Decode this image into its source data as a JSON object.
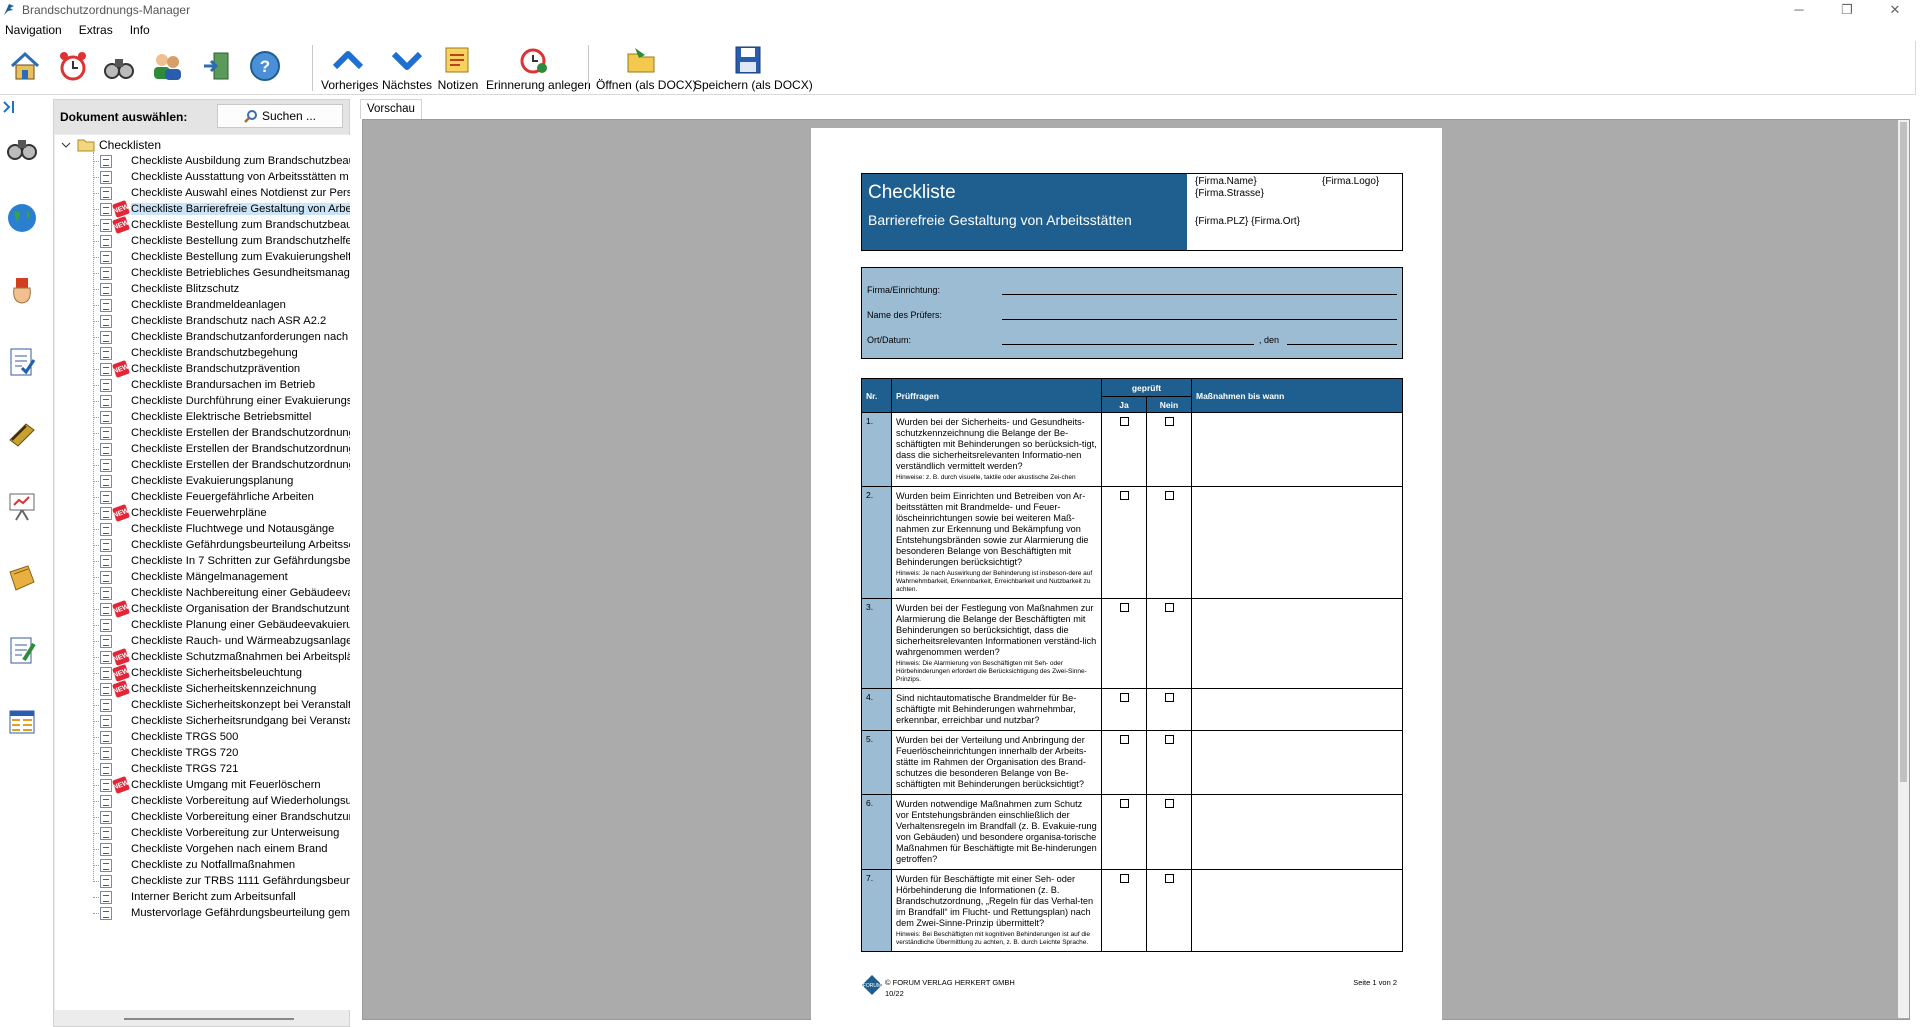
{
  "window": {
    "title": "Brandschutzordnungs-Manager",
    "controls": [
      "─",
      "❐",
      "✕"
    ]
  },
  "menu": [
    "Navigation",
    "Extras",
    "Info"
  ],
  "toolbar": {
    "left_icons": [
      "home-icon",
      "alarm-clock-icon",
      "binoculars-icon",
      "users-icon",
      "exit-icon",
      "help-icon"
    ],
    "buttons": [
      {
        "name": "previous-button",
        "label": "Vorheriges",
        "icon": "chevron-up-icon"
      },
      {
        "name": "next-button",
        "label": "Nächstes",
        "icon": "chevron-down-icon"
      },
      {
        "name": "notes-button",
        "label": "Notizen",
        "icon": "notes-icon"
      },
      {
        "name": "reminder-button",
        "label": "Erinnerung anlegen",
        "icon": "alarm-add-icon"
      },
      {
        "name": "open-docx-button",
        "label": "Öffnen (als DOCX)",
        "icon": "folder-open-icon"
      },
      {
        "name": "save-docx-button",
        "label": "Speichern (als DOCX)",
        "icon": "floppy-icon"
      }
    ]
  },
  "docpanel": {
    "header": "Dokument auswählen:",
    "search_label": "Suchen ...",
    "root": "Checklisten"
  },
  "tree_items": [
    {
      "label": "Checkliste Ausbildung zum Brandschutzbeauf",
      "new": false
    },
    {
      "label": "Checkliste Ausstattung von Arbeitsstätten m",
      "new": false
    },
    {
      "label": "Checkliste Auswahl eines Notdienst zur Pers",
      "new": false
    },
    {
      "label": "Checkliste Barrierefreie Gestaltung von Arbei",
      "new": true,
      "selected": true
    },
    {
      "label": "Checkliste Bestellung zum Brandschutzbeauf",
      "new": true
    },
    {
      "label": "Checkliste Bestellung zum Brandschutzhelfer",
      "new": false
    },
    {
      "label": "Checkliste Bestellung zum Evakuierungshelfe",
      "new": false
    },
    {
      "label": "Checkliste Betriebliches Gesundheitsmanager",
      "new": false
    },
    {
      "label": "Checkliste Blitzschutz",
      "new": false
    },
    {
      "label": "Checkliste Brandmeldeanlagen",
      "new": false
    },
    {
      "label": "Checkliste Brandschutz nach ASR A2.2",
      "new": false
    },
    {
      "label": "Checkliste Brandschutzanforderungen nach N",
      "new": false
    },
    {
      "label": "Checkliste Brandschutzbegehung",
      "new": false
    },
    {
      "label": "Checkliste Brandschutzprävention",
      "new": true
    },
    {
      "label": "Checkliste Brandursachen im Betrieb",
      "new": false
    },
    {
      "label": "Checkliste Durchführung einer Evakuierungsü",
      "new": false
    },
    {
      "label": "Checkliste Elektrische Betriebsmittel",
      "new": false
    },
    {
      "label": "Checkliste Erstellen der Brandschutzordnung",
      "new": false
    },
    {
      "label": "Checkliste Erstellen der Brandschutzordnung",
      "new": false
    },
    {
      "label": "Checkliste Erstellen der Brandschutzordnung",
      "new": false
    },
    {
      "label": "Checkliste Evakuierungsplanung",
      "new": false
    },
    {
      "label": "Checkliste Feuergefährliche Arbeiten",
      "new": false
    },
    {
      "label": "Checkliste Feuerwehrpläne",
      "new": true
    },
    {
      "label": "Checkliste Fluchtwege und Notausgänge",
      "new": false
    },
    {
      "label": "Checkliste Gefährdungsbeurteilung Arbeitssc",
      "new": false
    },
    {
      "label": "Checkliste In 7 Schritten zur Gefährdungsbeu",
      "new": false
    },
    {
      "label": "Checkliste Mängelmanagement",
      "new": false
    },
    {
      "label": "Checkliste Nachbereitung einer Gebäudeevak",
      "new": false
    },
    {
      "label": "Checkliste Organisation der Brandschutzunte",
      "new": true
    },
    {
      "label": "Checkliste Planung einer Gebäudeevakuierun",
      "new": false
    },
    {
      "label": "Checkliste Rauch- und Wärmeabzugsanlagen",
      "new": false
    },
    {
      "label": "Checkliste Schutzmaßnahmen bei Arbeitsplät",
      "new": true
    },
    {
      "label": "Checkliste Sicherheitsbeleuchtung",
      "new": true
    },
    {
      "label": "Checkliste Sicherheitskennzeichnung",
      "new": true
    },
    {
      "label": "Checkliste Sicherheitskonzept bei Veranstaltu",
      "new": false
    },
    {
      "label": "Checkliste Sicherheitsrundgang bei Veranstal",
      "new": false
    },
    {
      "label": "Checkliste TRGS 500",
      "new": false
    },
    {
      "label": "Checkliste TRGS 720",
      "new": false
    },
    {
      "label": "Checkliste TRGS 721",
      "new": false
    },
    {
      "label": "Checkliste Umgang mit Feuerlöschern",
      "new": true
    },
    {
      "label": "Checkliste Vorbereitung auf Wiederholungsur",
      "new": false
    },
    {
      "label": "Checkliste Vorbereitung einer Brandschutzun",
      "new": false
    },
    {
      "label": "Checkliste Vorbereitung zur Unterweisung",
      "new": false
    },
    {
      "label": "Checkliste Vorgehen nach einem Brand",
      "new": false
    },
    {
      "label": "Checkliste zu Notfallmaßnahmen",
      "new": false
    },
    {
      "label": "Checkliste zur TRBS 1111 Gefährdungsbeurte",
      "new": false
    },
    {
      "label": "Interner Bericht zum Arbeitsunfall",
      "new": false
    },
    {
      "label": "Mustervorlage Gefährdungsbeurteilung gemä",
      "new": false
    }
  ],
  "sidebar_icons": [
    "binoculars-icon",
    "globe-icon",
    "hand-icon",
    "checklist-icon",
    "book-icon",
    "presentation-icon",
    "folder-book-icon",
    "edit-document-icon",
    "table-icon"
  ],
  "tab": "Vorschau",
  "preview": {
    "title": "Checkliste",
    "subtitle": "Barrierefreie Gestaltung von Arbeitsstätten",
    "firma_name": "{Firma.Name}",
    "firma_logo": "{Firma.Logo}",
    "firma_strasse": "{Firma.Strasse}",
    "firma_ort": "{Firma.PLZ} {Firma.Ort}",
    "form": {
      "firma": "Firma/Einrichtung:",
      "pruefer": "Name des Prüfers:",
      "ort": "Ort/Datum:",
      "den": ", den"
    },
    "table": {
      "h_nr": "Nr.",
      "h_fragen": "Prüffragen",
      "h_geprueft": "geprüft",
      "h_ja": "Ja",
      "h_nein": "Nein",
      "h_mass": "Maßnahmen bis wann",
      "rows": [
        {
          "nr": "1.",
          "q": "Wurden bei der Sicherheits- und Gesundheits-schutzkennzeichnung die Belange der Be-schäftigten mit Behinderungen so berücksich-tigt, dass die sicherheitsrelevanten Informatio-nen verständlich vermittelt werden?",
          "hint": "Hinweise: z. B. durch visuelle, taktile oder akustische Zei-chen"
        },
        {
          "nr": "2.",
          "q": "Wurden beim Einrichten und Betreiben von Ar-beitsstätten mit Brandmelde- und Feuer-löscheinrichtungen sowie bei weiteren Maß-nahmen zur Erkennung und Bekämpfung von Entstehungsbränden sowie zur Alarmierung die besonderen Belange von Beschäftigten mit Behinderungen berücksichtigt?",
          "hint": "Hinweis: Je nach Auswirkung der Behinderung ist insbeson-dere auf Wahrnehmbarkeit, Erkennbarkeit, Erreichbarkeit und Nutzbarkeit zu achten."
        },
        {
          "nr": "3.",
          "q": "Wurden bei der Festlegung von Maßnahmen zur Alarmierung die Belange der Beschäftigten mit Behinderungen so berücksichtigt, dass die sicherheitsrelevanten Informationen verständ-lich wahrgenommen werden?",
          "hint": "Hinweis: Die Alarmierung von Beschäftigten mit Seh- oder Hörbehinderungen erfordert die Berücksichtigung des Zwei-Sinne-Prinzips."
        },
        {
          "nr": "4.",
          "q": "Sind nichtautomatische Brandmelder für Be-schäftigte mit Behinderungen wahrnehmbar, erkennbar, erreichbar und nutzbar?",
          "hint": ""
        },
        {
          "nr": "5.",
          "q": "Wurden bei der Verteilung und Anbringung der Feuerlöscheinrichtungen innerhalb der Arbeits-stätte im Rahmen der Organisation des Brand-schutzes die besonderen Belange von Be-schäftigten mit Behinderungen berücksichtigt?",
          "hint": ""
        },
        {
          "nr": "6.",
          "q": "Wurden notwendige Maßnahmen zum Schutz vor Entstehungsbränden einschließlich der Verhaltensregeln im Brandfall (z. B. Evakuie-rung von Gebäuden) und besondere organisa-torische Maßnahmen für Beschäftigte mit Be-hinderungen getroffen?",
          "hint": ""
        },
        {
          "nr": "7.",
          "q": "Wurden für Beschäftigte mit einer Seh- oder Hörbehinderung die Informationen (z. B. Brandschutzordnung, „Regeln für das Verhal-ten im Brandfall“ im Flucht- und Rettungsplan) nach dem Zwei-Sinne-Prinzip übermittelt?",
          "hint": "Hinweis: Bei Beschäftigten mit kognitiven Behinderungen ist auf die verständliche Übermittlung zu achten, z. B. durch Leichte Sprache."
        }
      ]
    },
    "footer": {
      "copyright": "© FORUM VERLAG HERKERT GMBH",
      "date": "10/22",
      "page": "Seite 1 von 2"
    }
  },
  "colors": {
    "accent": "#1f5f8f",
    "light_blue": "#9cbcd4",
    "preview_bg": "#ababab",
    "new_badge": "#e32636"
  }
}
